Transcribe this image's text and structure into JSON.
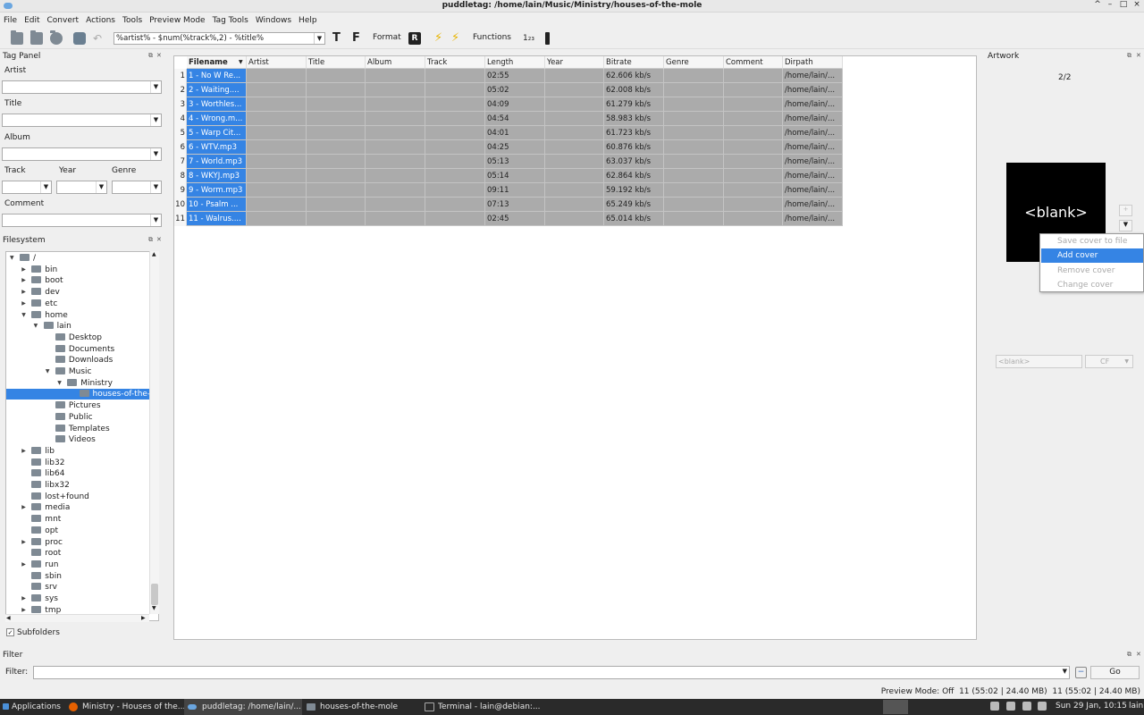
{
  "window": {
    "title": "puddletag: /home/lain/Music/Ministry/houses-of-the-mole",
    "controls": [
      "^",
      "–",
      "□",
      "×"
    ]
  },
  "menu": [
    "File",
    "Edit",
    "Convert",
    "Actions",
    "Tools",
    "Preview Mode",
    "Tag Tools",
    "Windows",
    "Help"
  ],
  "toolbar": {
    "pattern": "%artist% - $num(%track%,2) - %title%",
    "format_label": "Format",
    "functions_label": "Functions"
  },
  "tag_panel": {
    "title": "Tag Panel",
    "labels": {
      "artist": "Artist",
      "title": "Title",
      "album": "Album",
      "track": "Track",
      "year": "Year",
      "genre": "Genre",
      "comment": "Comment"
    }
  },
  "filesystem": {
    "title": "Filesystem",
    "subfolders_label": "Subfolders",
    "nodes": [
      "/",
      "bin",
      "boot",
      "dev",
      "etc",
      "home",
      "lain",
      "Desktop",
      "Documents",
      "Downloads",
      "Music",
      "Ministry",
      "houses-of-the-mole",
      "Pictures",
      "Public",
      "Templates",
      "Videos",
      "lib",
      "lib32",
      "lib64",
      "libx32",
      "lost+found",
      "media",
      "mnt",
      "opt",
      "proc",
      "root",
      "run",
      "sbin",
      "srv",
      "sys",
      "tmp"
    ]
  },
  "table": {
    "columns": [
      "Filename",
      "Artist",
      "Title",
      "Album",
      "Track",
      "Length",
      "Year",
      "Bitrate",
      "Genre",
      "Comment",
      "Dirpath"
    ],
    "rows": [
      {
        "n": "1",
        "filename": "1 - No W Re...",
        "length": "02:55",
        "bitrate": "62.606 kb/s",
        "dirpath": "/home/lain/..."
      },
      {
        "n": "2",
        "filename": "2 - Waiting....",
        "length": "05:02",
        "bitrate": "62.008 kb/s",
        "dirpath": "/home/lain/..."
      },
      {
        "n": "3",
        "filename": "3 - Worthles...",
        "length": "04:09",
        "bitrate": "61.279 kb/s",
        "dirpath": "/home/lain/..."
      },
      {
        "n": "4",
        "filename": "4 - Wrong.m...",
        "length": "04:54",
        "bitrate": "58.983 kb/s",
        "dirpath": "/home/lain/..."
      },
      {
        "n": "5",
        "filename": "5 - Warp Cit...",
        "length": "04:01",
        "bitrate": "61.723 kb/s",
        "dirpath": "/home/lain/..."
      },
      {
        "n": "6",
        "filename": "6 - WTV.mp3",
        "length": "04:25",
        "bitrate": "60.876 kb/s",
        "dirpath": "/home/lain/..."
      },
      {
        "n": "7",
        "filename": "7 - World.mp3",
        "length": "05:13",
        "bitrate": "63.037 kb/s",
        "dirpath": "/home/lain/..."
      },
      {
        "n": "8",
        "filename": "8 - WKYJ.mp3",
        "length": "05:14",
        "bitrate": "62.864 kb/s",
        "dirpath": "/home/lain/..."
      },
      {
        "n": "9",
        "filename": "9 - Worm.mp3",
        "length": "09:11",
        "bitrate": "59.192 kb/s",
        "dirpath": "/home/lain/..."
      },
      {
        "n": "10",
        "filename": "10 - Psalm ...",
        "length": "07:13",
        "bitrate": "65.249 kb/s",
        "dirpath": "/home/lain/..."
      },
      {
        "n": "11",
        "filename": "11 - Walrus....",
        "length": "02:45",
        "bitrate": "65.014 kb/s",
        "dirpath": "/home/lain/..."
      }
    ]
  },
  "artwork": {
    "title": "Artwork",
    "counter": "2/2",
    "image_label": "<blank>",
    "desc_placeholder": "<blank>",
    "type_value": "CF",
    "menu": [
      "Save cover to file",
      "Add cover",
      "Remove cover",
      "Change cover"
    ]
  },
  "filter": {
    "title": "Filter",
    "label": "Filter:",
    "go_label": "Go"
  },
  "status": "Preview Mode: Off  11 (55:02 | 24.40 MB)  11 (55:02 | 24.40 MB)",
  "taskbar": {
    "start": "Applications",
    "tasks": [
      "Ministry - Houses of the...",
      "puddletag: /home/lain/...",
      "houses-of-the-mole",
      "Terminal - lain@debian:..."
    ],
    "clock": "Sun 29 Jan, 10:15",
    "user": "lain"
  }
}
